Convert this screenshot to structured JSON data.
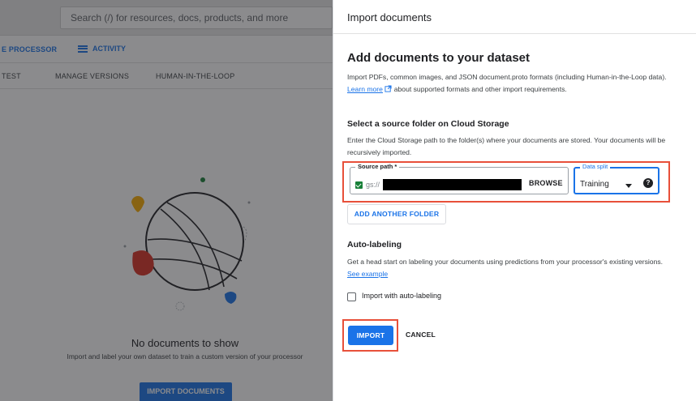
{
  "background": {
    "search_placeholder": "Search (/) for resources, docs, products, and more",
    "toolbar": {
      "processor_action": "E PROCESSOR",
      "activity": "ACTIVITY"
    },
    "tabs": [
      "TEST",
      "MANAGE VERSIONS",
      "HUMAN-IN-THE-LOOP"
    ],
    "empty_state": {
      "title": "No documents to show",
      "subtitle": "Import and label your own dataset to train a custom version of your processor",
      "button": "IMPORT DOCUMENTS"
    }
  },
  "panel": {
    "title": "Import documents",
    "heading": "Add documents to your dataset",
    "intro_text": "Import PDFs, common images, and JSON document.proto formats (including Human-in-the-Loop data).",
    "learn_more": "Learn more",
    "intro_suffix": "about supported formats and other import requirements.",
    "source_section": {
      "heading": "Select a source folder on Cloud Storage",
      "description": "Enter the Cloud Storage path to the folder(s) where your documents are stored. Your documents will be recursively imported.",
      "source_path_label": "Source path *",
      "source_path_prefix": "gs://",
      "browse_label": "BROWSE",
      "data_split_label": "Data split",
      "data_split_value": "Training",
      "add_folder_label": "ADD ANOTHER FOLDER"
    },
    "auto_labeling": {
      "heading": "Auto-labeling",
      "description": "Get a head start on labeling your documents using predictions from your processor's existing versions.",
      "see_example": "See example",
      "checkbox_label": "Import with auto-labeling",
      "checked": false
    },
    "actions": {
      "import": "IMPORT",
      "cancel": "CANCEL"
    }
  },
  "colors": {
    "accent": "#1a73e8",
    "highlight": "#e8503a",
    "success": "#188038"
  }
}
